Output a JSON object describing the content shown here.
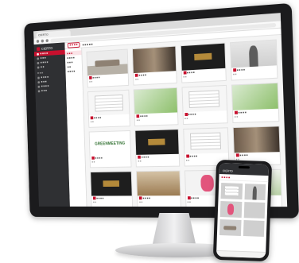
{
  "brand": {
    "name": "CIERTO",
    "accent": "#c8102e"
  },
  "browser_tab": "CIERTO",
  "sidebar": {
    "groups": [
      {
        "label": "",
        "items": [
          {
            "label": "■ ■ ■ ■",
            "active": true
          },
          {
            "label": "■ ■ ■",
            "active": false
          },
          {
            "label": "■ ■ ■ ■",
            "active": false
          },
          {
            "label": "■ ■",
            "active": false
          }
        ]
      },
      {
        "label": "■ ■ ■",
        "items": [
          {
            "label": "■ ■ ■ ■",
            "active": false
          },
          {
            "label": "■ ■ ■",
            "active": false
          },
          {
            "label": "■ ■ ■ ■",
            "active": false
          },
          {
            "label": "■ ■ ■",
            "active": false
          }
        ]
      }
    ]
  },
  "toolbar": {
    "buttons": [
      "■ ■ ■",
      "■ ■ ■ ■",
      "■ ■ ■",
      "■ ■ ■ ■ ■",
      "■ ■ ■ ■",
      "■ ■ ■ ■ ■ ■",
      "■ ■ ■ ■ ■ ■"
    ]
  },
  "subbar": {
    "filter": "■ ■ ■ ■",
    "crumbs": "■ ■ ■ ■ ■"
  },
  "tree": {
    "rows": [
      "■ ■ ■",
      "■ ■ ■ ■",
      "■ ■ ■",
      "■ ■",
      "■ ■ ■ ■"
    ]
  },
  "cards": [
    {
      "kind": "t-sofa",
      "caption": "■ ■ ■ ■",
      "meta": "■ ■"
    },
    {
      "kind": "t-room",
      "caption": "■ ■ ■ ■",
      "meta": "■ ■"
    },
    {
      "kind": "t-dark",
      "caption": "■ ■ ■ ■",
      "meta": "■ ■"
    },
    {
      "kind": "t-person",
      "caption": "■ ■ ■ ■",
      "meta": "■ ■"
    },
    {
      "kind": "t-doc",
      "caption": "■ ■ ■ ■",
      "meta": "■ ■"
    },
    {
      "kind": "t-leaf",
      "caption": "■ ■ ■ ■",
      "meta": "■ ■"
    },
    {
      "kind": "t-doc",
      "caption": "■ ■ ■ ■",
      "meta": "■ ■"
    },
    {
      "kind": "t-leaf",
      "caption": "■ ■ ■ ■",
      "meta": "■ ■"
    },
    {
      "kind": "t-text",
      "text": "GREENMEETING",
      "caption": "■ ■ ■ ■",
      "meta": "■ ■"
    },
    {
      "kind": "t-dark",
      "caption": "■ ■ ■ ■",
      "meta": "■ ■"
    },
    {
      "kind": "t-doc",
      "caption": "■ ■ ■ ■",
      "meta": "■ ■"
    },
    {
      "kind": "t-room",
      "caption": "■ ■ ■ ■",
      "meta": "■ ■"
    },
    {
      "kind": "t-dark",
      "caption": "■ ■ ■ ■",
      "meta": "■ ■"
    },
    {
      "kind": "t-wood",
      "caption": "■ ■ ■ ■",
      "meta": "■ ■"
    },
    {
      "kind": "t-pink",
      "caption": "■ ■ ■ ■",
      "meta": "■ ■"
    },
    {
      "kind": "t-plant",
      "caption": "■ ■ ■ ■",
      "meta": "■ ■"
    }
  ],
  "phone": {
    "title": "CIERTO",
    "tab": "■ ■ ■ ■",
    "cards": [
      "t-doc",
      "t-person",
      "t-pink",
      "t-room",
      "t-sofa",
      "t-wood"
    ]
  }
}
